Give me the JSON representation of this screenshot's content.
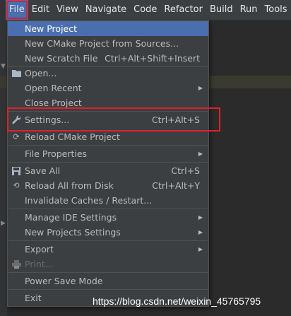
{
  "menubar": {
    "items": [
      "File",
      "Edit",
      "View",
      "Navigate",
      "Code",
      "Refactor",
      "Build",
      "Run",
      "Tools"
    ]
  },
  "file_menu": {
    "items": [
      {
        "label": "New Project",
        "shortcut": "",
        "submenu": false,
        "icon": "",
        "selected": true
      },
      {
        "label": "New CMake Project from Sources...",
        "shortcut": "",
        "submenu": false,
        "icon": ""
      },
      {
        "label": "New Scratch File",
        "shortcut": "Ctrl+Alt+Shift+Insert",
        "submenu": false,
        "icon": ""
      },
      {
        "label": "Open...",
        "shortcut": "",
        "submenu": false,
        "icon": "folder-icon"
      },
      {
        "label": "Open Recent",
        "shortcut": "",
        "submenu": true,
        "icon": ""
      },
      {
        "label": "Close Project",
        "shortcut": "",
        "submenu": false,
        "icon": ""
      },
      {
        "label": "Settings...",
        "shortcut": "Ctrl+Alt+S",
        "submenu": false,
        "icon": "wrench-icon"
      },
      {
        "label": "Reload CMake Project",
        "shortcut": "",
        "submenu": false,
        "icon": "reload-icon"
      },
      {
        "label": "File Properties",
        "shortcut": "",
        "submenu": true,
        "icon": ""
      },
      {
        "label": "Save All",
        "shortcut": "Ctrl+S",
        "submenu": false,
        "icon": "save-icon"
      },
      {
        "label": "Reload All from Disk",
        "shortcut": "Ctrl+Alt+Y",
        "submenu": false,
        "icon": "sync-icon"
      },
      {
        "label": "Invalidate Caches / Restart...",
        "shortcut": "",
        "submenu": false,
        "icon": ""
      },
      {
        "label": "Manage IDE Settings",
        "shortcut": "",
        "submenu": true,
        "icon": ""
      },
      {
        "label": "New Projects Settings",
        "shortcut": "",
        "submenu": true,
        "icon": ""
      },
      {
        "label": "Export",
        "shortcut": "",
        "submenu": true,
        "icon": ""
      },
      {
        "label": "Print...",
        "shortcut": "",
        "submenu": false,
        "icon": "printer-icon",
        "disabled": true
      },
      {
        "label": "Power Save Mode",
        "shortcut": "",
        "submenu": false,
        "icon": ""
      },
      {
        "label": "Exit",
        "shortcut": "",
        "submenu": false,
        "icon": ""
      }
    ]
  },
  "watermark": "https://blog.csdn.net/weixin_45765795",
  "colors": {
    "selection": "#4b6eaf",
    "annotation_box": "#e0202a",
    "menu_bg": "#3c3f41"
  }
}
